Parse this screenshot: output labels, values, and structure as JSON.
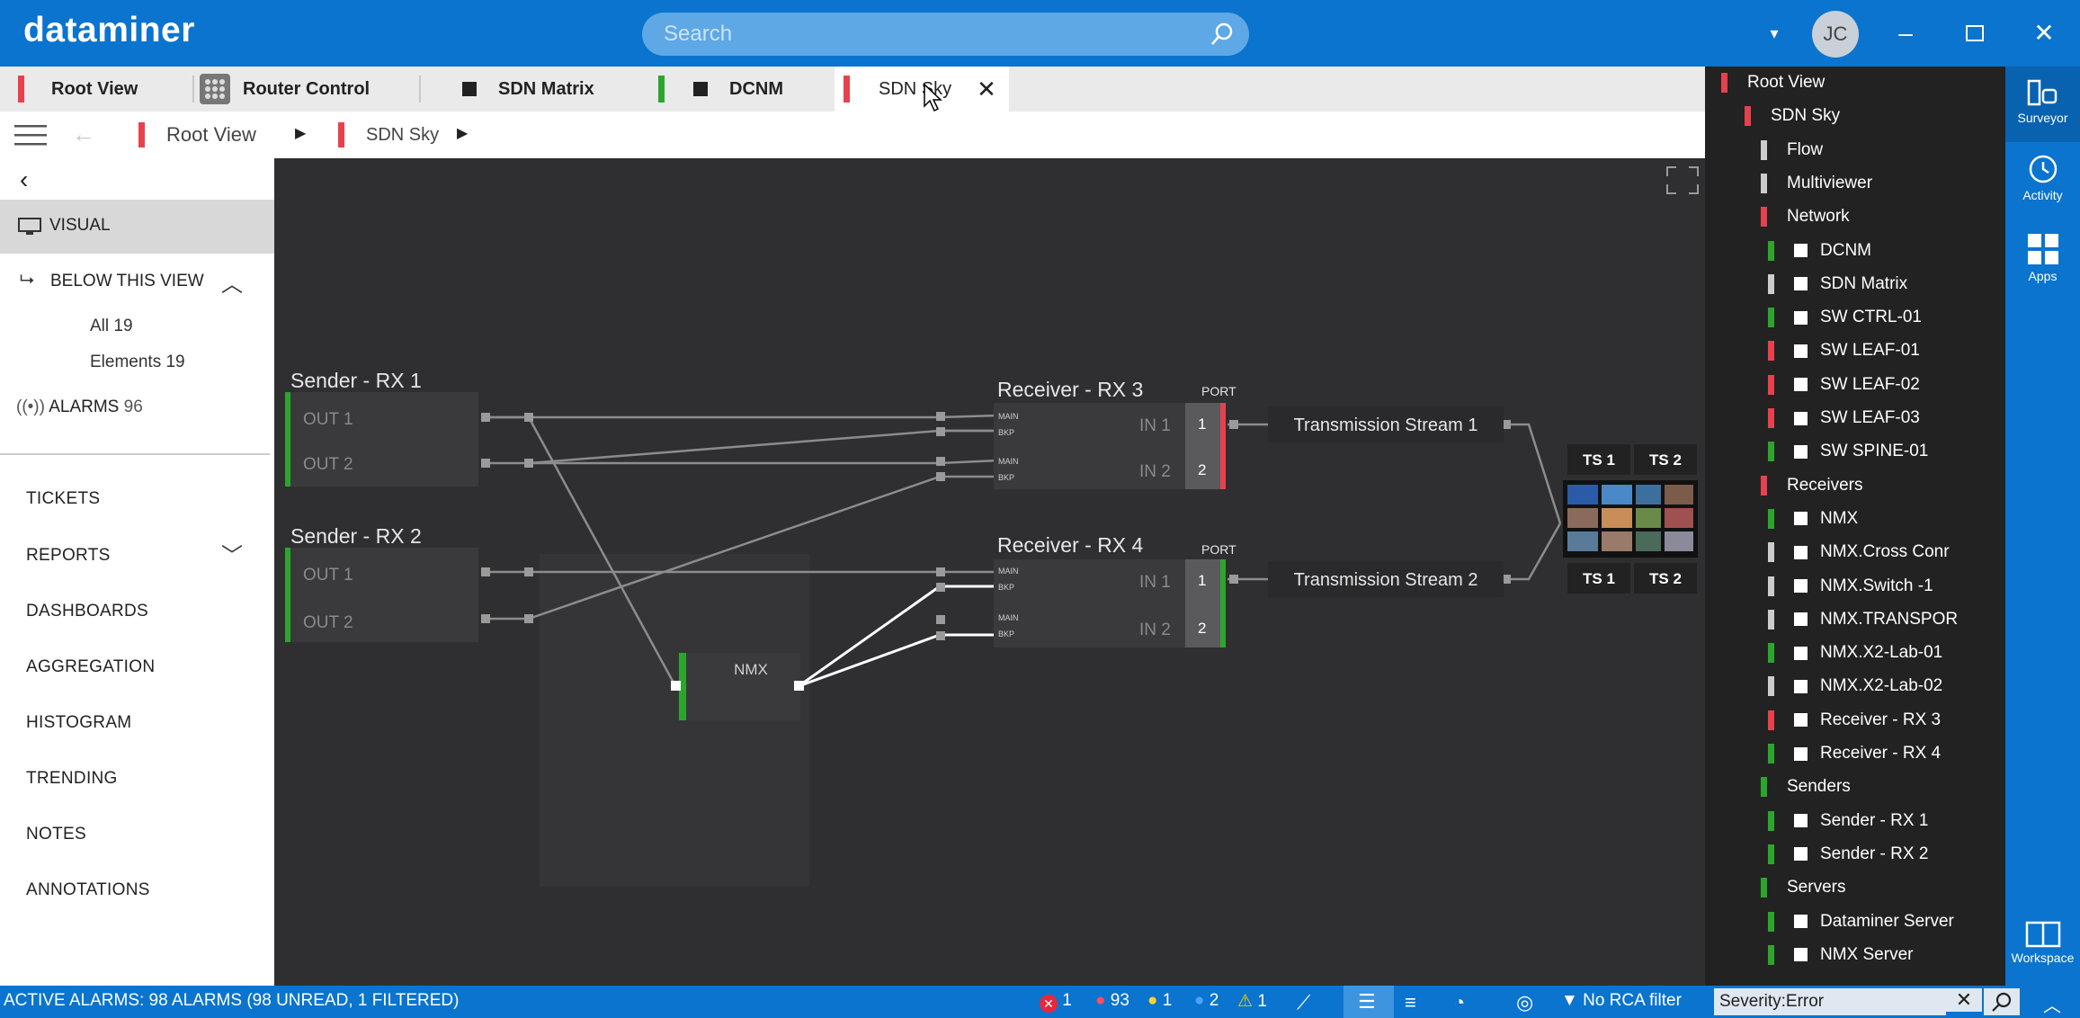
{
  "app": {
    "logo": "dataminer",
    "user_initials": "JC"
  },
  "search": {
    "placeholder": "Search"
  },
  "tabs": [
    {
      "label": "Root View",
      "color": "#e8414e"
    },
    {
      "label": "Router Control",
      "color": "#888888"
    },
    {
      "label": "SDN Matrix",
      "color": "#333333"
    },
    {
      "label": "DCNM",
      "color": "#2da52d"
    },
    {
      "label": "SDN Sky",
      "color": "#e8414e"
    }
  ],
  "breadcrumb": {
    "item1": "Root View",
    "item2": "SDN Sky"
  },
  "sidebar": {
    "visual": "VISUAL",
    "below": "BELOW THIS VIEW",
    "all": "All",
    "all_count": "19",
    "elements": "Elements",
    "elements_count": "19",
    "alarms": "ALARMS",
    "alarms_count": "96",
    "menu": [
      "TICKETS",
      "REPORTS",
      "DASHBOARDS",
      "AGGREGATION",
      "HISTOGRAM",
      "TRENDING",
      "NOTES",
      "ANNOTATIONS"
    ]
  },
  "diagram": {
    "sender1": {
      "title": "Sender - RX 1",
      "out1": "OUT 1",
      "out2": "OUT 2"
    },
    "sender2": {
      "title": "Sender - RX 2",
      "out1": "OUT 1",
      "out2": "OUT 2"
    },
    "receiver3": {
      "title": "Receiver - RX 3",
      "port": "PORT",
      "in1": "IN 1",
      "in2": "IN 2",
      "p1": "1",
      "p2": "2"
    },
    "receiver4": {
      "title": "Receiver - RX 4",
      "port": "PORT",
      "in1": "IN 1",
      "in2": "IN 2",
      "p1": "1",
      "p2": "2"
    },
    "main": "MAIN",
    "bkp": "BKP",
    "nmx": "NMX",
    "ts1": "Transmission Stream 1",
    "ts2": "Transmission Stream 2",
    "mv_ts1": "TS 1",
    "mv_ts2": "TS 2"
  },
  "tree": [
    {
      "label": "Root View",
      "level": 0,
      "color": "#e8414e",
      "box": false
    },
    {
      "label": "SDN Sky",
      "level": 1,
      "color": "#e8414e",
      "box": false
    },
    {
      "label": "Flow",
      "level": 2,
      "color": "#cccccc",
      "box": false
    },
    {
      "label": "Multiviewer",
      "level": 2,
      "color": "#cccccc",
      "box": false
    },
    {
      "label": "Network",
      "level": 2,
      "color": "#e8414e",
      "box": false
    },
    {
      "label": "DCNM",
      "level": 3,
      "color": "#2da52d",
      "box": true
    },
    {
      "label": "SDN Matrix",
      "level": 3,
      "color": "#cccccc",
      "box": true
    },
    {
      "label": "SW CTRL-01",
      "level": 3,
      "color": "#2da52d",
      "box": true
    },
    {
      "label": "SW LEAF-01",
      "level": 3,
      "color": "#e8414e",
      "box": true
    },
    {
      "label": "SW LEAF-02",
      "level": 3,
      "color": "#e8414e",
      "box": true
    },
    {
      "label": "SW LEAF-03",
      "level": 3,
      "color": "#e8414e",
      "box": true
    },
    {
      "label": "SW SPINE-01",
      "level": 3,
      "color": "#2da52d",
      "box": true
    },
    {
      "label": "Receivers",
      "level": 2,
      "color": "#e8414e",
      "box": false
    },
    {
      "label": "NMX",
      "level": 3,
      "color": "#2da52d",
      "box": true
    },
    {
      "label": "NMX.Cross Conr",
      "level": 3,
      "color": "#cccccc",
      "box": true
    },
    {
      "label": "NMX.Switch -1",
      "level": 3,
      "color": "#cccccc",
      "box": true
    },
    {
      "label": "NMX.TRANSPOR",
      "level": 3,
      "color": "#cccccc",
      "box": true
    },
    {
      "label": "NMX.X2-Lab-01",
      "level": 3,
      "color": "#2da52d",
      "box": true
    },
    {
      "label": "NMX.X2-Lab-02",
      "level": 3,
      "color": "#cccccc",
      "box": true
    },
    {
      "label": "Receiver - RX 3",
      "level": 3,
      "color": "#e8414e",
      "box": true
    },
    {
      "label": "Receiver - RX 4",
      "level": 3,
      "color": "#2da52d",
      "box": true
    },
    {
      "label": "Senders",
      "level": 2,
      "color": "#2da52d",
      "box": false
    },
    {
      "label": "Sender - RX 1",
      "level": 3,
      "color": "#2da52d",
      "box": true
    },
    {
      "label": "Sender - RX 2",
      "level": 3,
      "color": "#2da52d",
      "box": true
    },
    {
      "label": "Servers",
      "level": 2,
      "color": "#2da52d",
      "box": false
    },
    {
      "label": "Dataminer Server",
      "level": 3,
      "color": "#2da52d",
      "box": true
    },
    {
      "label": "NMX Server",
      "level": 3,
      "color": "#2da52d",
      "box": true
    }
  ],
  "rail": {
    "surveyor": "Surveyor",
    "activity": "Activity",
    "apps": "Apps",
    "workspace": "Workspace"
  },
  "status": {
    "active_alarms": "ACTIVE ALARMS: 98 ALARMS (98 UNREAD, 1 FILTERED)",
    "critical": "1",
    "major": "93",
    "minor": "1",
    "warning": "2",
    "notice": "1",
    "rca": "No RCA filter",
    "filter_value": "Severity:Error"
  }
}
